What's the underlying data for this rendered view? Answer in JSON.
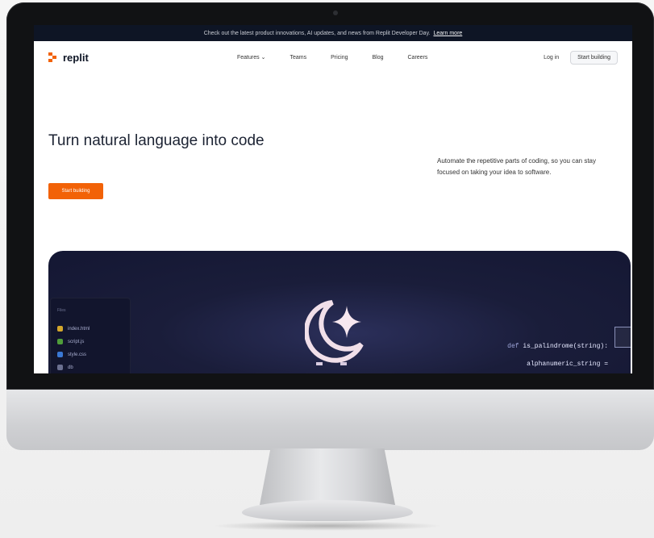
{
  "announcement": {
    "text": "Check out the latest product innovations, AI updates, and news from Replit Developer Day.",
    "link": "Learn more"
  },
  "header": {
    "logo_text": "replit",
    "nav_items": [
      {
        "label": "Features",
        "caret": "⌄"
      },
      {
        "label": "Teams"
      },
      {
        "label": "Pricing"
      },
      {
        "label": "Blog"
      },
      {
        "label": "Careers"
      }
    ],
    "login": "Log in",
    "start_building": "Start building"
  },
  "hero": {
    "headline": "Turn natural language into code",
    "subtext": "Automate the repetitive parts of coding, so you can stay focused on taking your idea to software.",
    "cta": "Start building"
  },
  "demo_panel": {
    "file_tree_label": "Files",
    "files": [
      {
        "name": "index.html",
        "color": "#d4a72c"
      },
      {
        "name": "script.js",
        "color": "#4f9d3a"
      },
      {
        "name": "style.css",
        "color": "#3a78d4"
      },
      {
        "name": "db",
        "color": "#6b7090"
      }
    ],
    "code_lines": [
      {
        "kw": "def",
        "fn": "is_palindrome(string):"
      },
      {
        "kw": "",
        "fn": "alphanumeric_string ="
      }
    ]
  },
  "colors": {
    "accent": "#f26207",
    "dark": "#0e1525",
    "panel": "#1a1d3a"
  }
}
